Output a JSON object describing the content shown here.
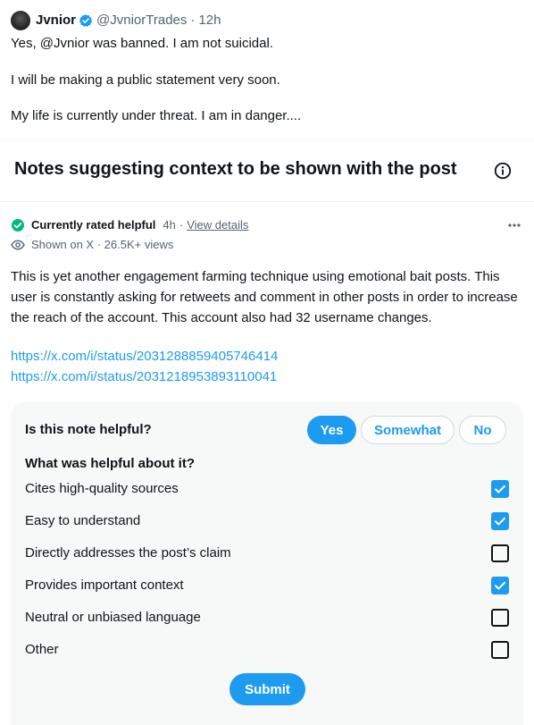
{
  "tweet": {
    "author_name": "Jvnior",
    "author_handle": "@JvniorTrades",
    "separator": "·",
    "time": "12h",
    "lines": [
      "Yes, @Jvnior was banned. I am not suicidal.",
      "I will be making a public statement very soon.",
      "My life is currently under threat. I am in danger...."
    ]
  },
  "notes_section": {
    "title": "Notes suggesting context to be shown with the post"
  },
  "note": {
    "status_label": "Currently rated helpful",
    "age": "4h",
    "separator": "·",
    "view_details": "View details",
    "shown_on": "Shown on X · 26.5K+ views",
    "body": "This is yet another engagement farming technique using emotional bait posts. This user is constantly asking for retweets and comment in other posts in order to increase the reach of the account. This account also had 32 username changes.",
    "links": [
      "https://x.com/i/status/2031288859405746414",
      "https://x.com/i/status/2031218953893110041"
    ]
  },
  "rating": {
    "question": "Is this note helpful?",
    "options": {
      "yes": "Yes",
      "somewhat": "Somewhat",
      "no": "No"
    },
    "selected": "Yes",
    "helpful_question": "What was helpful about it?",
    "reasons": [
      {
        "label": "Cites high-quality sources",
        "checked": true
      },
      {
        "label": "Easy to understand",
        "checked": true
      },
      {
        "label": "Directly addresses the post’s claim",
        "checked": false
      },
      {
        "label": "Provides important context",
        "checked": true
      },
      {
        "label": "Neutral or unbiased language",
        "checked": false
      },
      {
        "label": "Other",
        "checked": false
      }
    ],
    "submit_label": "Submit"
  },
  "colors": {
    "accent": "#1d9bf0",
    "helpful_green": "#00ba7c",
    "text": "#0f1419",
    "secondary_text": "#536471"
  },
  "icons": {
    "verified": "verified-badge-icon",
    "info": "info-circle-icon",
    "rated": "check-circle-icon",
    "more": "more-horizontal-icon",
    "shown": "eye-icon",
    "checkbox": "checkmark-icon"
  }
}
